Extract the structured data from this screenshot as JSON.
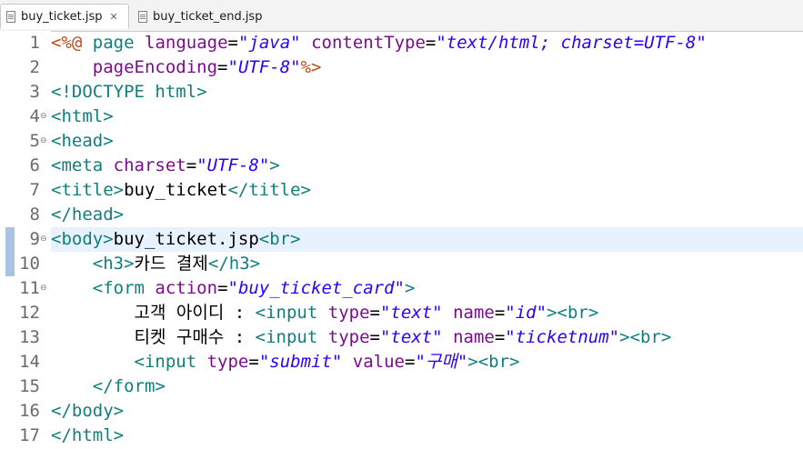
{
  "tabs": [
    {
      "label": "buy_ticket.jsp",
      "active": true,
      "close_icon": "✕"
    },
    {
      "label": "buy_ticket_end.jsp",
      "active": false
    }
  ],
  "colors": {
    "tag": "#117d7d",
    "attribute": "#7a0d8a",
    "string": "#2a00ff",
    "text": "#000000",
    "jsp": "#c04a1a",
    "current_line": "#e8f2fe"
  },
  "current_line": 9,
  "lines": [
    {
      "n": "1",
      "fold": false,
      "tokens": [
        {
          "t": "jsp",
          "v": "<%@"
        },
        {
          "t": "text",
          "v": " "
        },
        {
          "t": "tag",
          "v": "page"
        },
        {
          "t": "text",
          "v": " "
        },
        {
          "t": "attr",
          "v": "language"
        },
        {
          "t": "text",
          "v": "="
        },
        {
          "t": "str",
          "v": "\"java\""
        },
        {
          "t": "text",
          "v": " "
        },
        {
          "t": "attr",
          "v": "contentType"
        },
        {
          "t": "text",
          "v": "="
        },
        {
          "t": "str",
          "v": "\"text/html; charset=UTF-8\""
        }
      ]
    },
    {
      "n": "2",
      "fold": false,
      "tokens": [
        {
          "t": "text",
          "v": "    "
        },
        {
          "t": "attr",
          "v": "pageEncoding"
        },
        {
          "t": "text",
          "v": "="
        },
        {
          "t": "str",
          "v": "\"UTF-8\""
        },
        {
          "t": "jsp",
          "v": "%>"
        }
      ]
    },
    {
      "n": "3",
      "fold": false,
      "tokens": [
        {
          "t": "tag",
          "v": "<!DOCTYPE html>"
        }
      ]
    },
    {
      "n": "4",
      "fold": true,
      "tokens": [
        {
          "t": "tag",
          "v": "<html>"
        }
      ]
    },
    {
      "n": "5",
      "fold": true,
      "tokens": [
        {
          "t": "tag",
          "v": "<head>"
        }
      ]
    },
    {
      "n": "6",
      "fold": false,
      "tokens": [
        {
          "t": "tag",
          "v": "<meta"
        },
        {
          "t": "text",
          "v": " "
        },
        {
          "t": "attr",
          "v": "charset"
        },
        {
          "t": "text",
          "v": "="
        },
        {
          "t": "str",
          "v": "\"UTF-8\""
        },
        {
          "t": "tag",
          "v": ">"
        }
      ]
    },
    {
      "n": "7",
      "fold": false,
      "tokens": [
        {
          "t": "tag",
          "v": "<title>"
        },
        {
          "t": "text",
          "v": "buy_ticket"
        },
        {
          "t": "tag",
          "v": "</title>"
        }
      ]
    },
    {
      "n": "8",
      "fold": false,
      "tokens": [
        {
          "t": "tag",
          "v": "</head>"
        }
      ]
    },
    {
      "n": "9",
      "fold": true,
      "tokens": [
        {
          "t": "tag",
          "v": "<body>"
        },
        {
          "t": "text",
          "v": "buy_ticket.jsp"
        },
        {
          "t": "tag",
          "v": "<br>"
        }
      ]
    },
    {
      "n": "10",
      "fold": false,
      "tokens": [
        {
          "t": "text",
          "v": "    "
        },
        {
          "t": "tag",
          "v": "<h3>"
        },
        {
          "t": "text",
          "v": "카드 결제"
        },
        {
          "t": "tag",
          "v": "</h3>"
        }
      ]
    },
    {
      "n": "11",
      "fold": true,
      "tokens": [
        {
          "t": "text",
          "v": "    "
        },
        {
          "t": "tag",
          "v": "<form"
        },
        {
          "t": "text",
          "v": " "
        },
        {
          "t": "attr",
          "v": "action"
        },
        {
          "t": "text",
          "v": "="
        },
        {
          "t": "str",
          "v": "\"buy_ticket_card\""
        },
        {
          "t": "tag",
          "v": ">"
        }
      ]
    },
    {
      "n": "12",
      "fold": false,
      "tokens": [
        {
          "t": "text",
          "v": "        고객 아이디 : "
        },
        {
          "t": "tag",
          "v": "<input"
        },
        {
          "t": "text",
          "v": " "
        },
        {
          "t": "attr",
          "v": "type"
        },
        {
          "t": "text",
          "v": "="
        },
        {
          "t": "str",
          "v": "\"text\""
        },
        {
          "t": "text",
          "v": " "
        },
        {
          "t": "attr",
          "v": "name"
        },
        {
          "t": "text",
          "v": "="
        },
        {
          "t": "str",
          "v": "\"id\""
        },
        {
          "t": "tag",
          "v": "><br>"
        }
      ]
    },
    {
      "n": "13",
      "fold": false,
      "tokens": [
        {
          "t": "text",
          "v": "        티켓 구매수 : "
        },
        {
          "t": "tag",
          "v": "<input"
        },
        {
          "t": "text",
          "v": " "
        },
        {
          "t": "attr",
          "v": "type"
        },
        {
          "t": "text",
          "v": "="
        },
        {
          "t": "str",
          "v": "\"text\""
        },
        {
          "t": "text",
          "v": " "
        },
        {
          "t": "attr",
          "v": "name"
        },
        {
          "t": "text",
          "v": "="
        },
        {
          "t": "str",
          "v": "\"ticketnum\""
        },
        {
          "t": "tag",
          "v": "><br>"
        }
      ]
    },
    {
      "n": "14",
      "fold": false,
      "tokens": [
        {
          "t": "text",
          "v": "        "
        },
        {
          "t": "tag",
          "v": "<input"
        },
        {
          "t": "text",
          "v": " "
        },
        {
          "t": "attr",
          "v": "type"
        },
        {
          "t": "text",
          "v": "="
        },
        {
          "t": "str",
          "v": "\"submit\""
        },
        {
          "t": "text",
          "v": " "
        },
        {
          "t": "attr",
          "v": "value"
        },
        {
          "t": "text",
          "v": "="
        },
        {
          "t": "str",
          "v": "\"구매\""
        },
        {
          "t": "tag",
          "v": "><br>"
        }
      ]
    },
    {
      "n": "15",
      "fold": false,
      "tokens": [
        {
          "t": "text",
          "v": "    "
        },
        {
          "t": "tag",
          "v": "</form>"
        }
      ]
    },
    {
      "n": "16",
      "fold": false,
      "tokens": [
        {
          "t": "tag",
          "v": "</body>"
        }
      ]
    },
    {
      "n": "17",
      "fold": false,
      "tokens": [
        {
          "t": "tag",
          "v": "</html>"
        }
      ]
    }
  ]
}
